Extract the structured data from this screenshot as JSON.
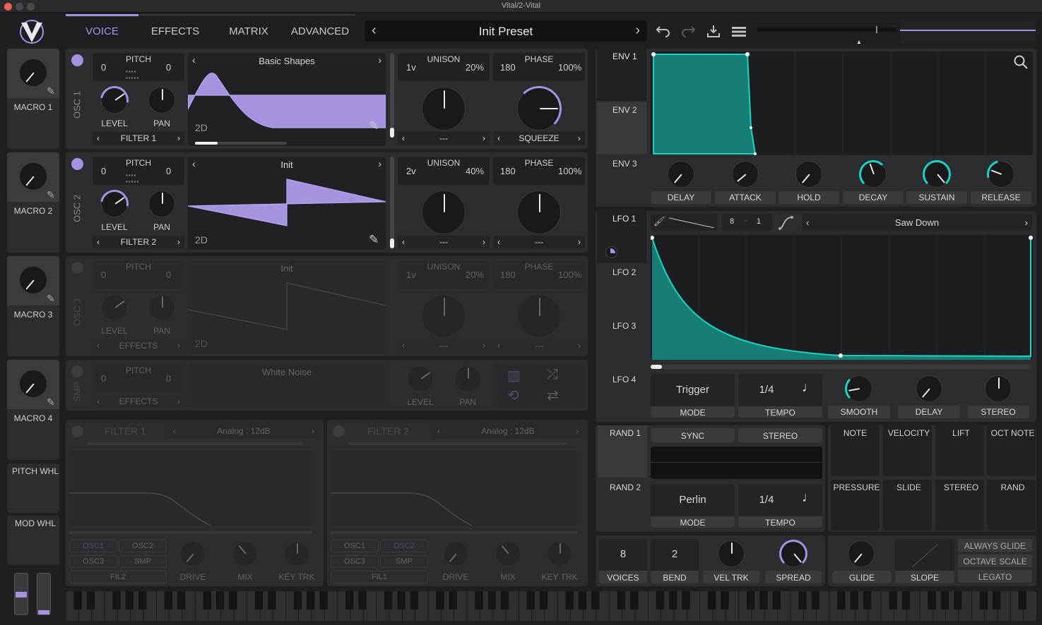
{
  "window": {
    "title": "Vital/2-Vital"
  },
  "nav": {
    "tabs": [
      "VOICE",
      "EFFECTS",
      "MATRIX",
      "ADVANCED"
    ],
    "active": "VOICE"
  },
  "preset": {
    "name": "Init Preset"
  },
  "macros": [
    "MACRO 1",
    "MACRO 2",
    "MACRO 3",
    "MACRO 4"
  ],
  "wheels": {
    "pitch": "PITCH WHL",
    "mod": "MOD WHL"
  },
  "common": {
    "pitch": "PITCH",
    "level": "LEVEL",
    "pan": "PAN",
    "unison": "UNISON",
    "phase": "PHASE",
    "dim2d": "2D",
    "dash": "---"
  },
  "osc1": {
    "label": "OSC 1",
    "transpose": "0",
    "tune": "0",
    "wavetable": "Basic Shapes",
    "voices": "1v",
    "detune": "20%",
    "phase": "180",
    "phase_mix": "100%",
    "dest": "FILTER 1",
    "spectral": "SQUEEZE"
  },
  "osc2": {
    "label": "OSC 2",
    "transpose": "0",
    "tune": "0",
    "wavetable": "Init",
    "voices": "2v",
    "detune": "40%",
    "phase": "180",
    "phase_mix": "100%",
    "dest": "FILTER 2",
    "spectral": "---"
  },
  "osc3": {
    "label": "OSC 3",
    "transpose": "0",
    "tune": "0",
    "wavetable": "Init",
    "voices": "1v",
    "detune": "20%",
    "phase": "180",
    "phase_mix": "100%",
    "dest": "EFFECTS",
    "spectral": "---"
  },
  "smp": {
    "label": "SMP",
    "transpose": "0",
    "tune": "0",
    "sample": "White Noise",
    "dest": "EFFECTS"
  },
  "filter1": {
    "label": "FILTER 1",
    "model": "Analog : 12dB",
    "src": [
      "OSC1",
      "OSC2",
      "OSC3",
      "SMP"
    ],
    "fil": "FIL2",
    "drive": "DRIVE",
    "mix": "MIX",
    "keytrk": "KEY TRK"
  },
  "filter2": {
    "label": "FILTER 2",
    "model": "Analog : 12dB",
    "src": [
      "OSC1",
      "OSC2",
      "OSC3",
      "SMP"
    ],
    "fil": "FIL1",
    "drive": "DRIVE",
    "mix": "MIX",
    "keytrk": "KEY TRK"
  },
  "env": {
    "tabs": [
      "ENV 1",
      "ENV 2",
      "ENV 3"
    ],
    "knobs": [
      "DELAY",
      "ATTACK",
      "HOLD",
      "DECAY",
      "SUSTAIN",
      "RELEASE"
    ]
  },
  "lfo": {
    "tabs": [
      "LFO 1",
      "LFO 2",
      "LFO 3",
      "LFO 4"
    ],
    "grid_x": "8",
    "grid_y": "1",
    "shape": "Saw Down",
    "trigger": "Trigger",
    "mode": "MODE",
    "rate": "1/4",
    "tempo": "TEMPO",
    "knobs": [
      "SMOOTH",
      "DELAY",
      "STEREO"
    ]
  },
  "rand": {
    "tabs": [
      "RAND 1",
      "RAND 2"
    ],
    "sync": "SYNC",
    "stereo": "STEREO",
    "style1": "Perlin",
    "mode": "MODE",
    "rate": "1/4",
    "tempo": "TEMPO"
  },
  "mods": {
    "row1": [
      "NOTE",
      "VELOCITY",
      "LIFT",
      "OCT NOTE"
    ],
    "row2": [
      "PRESSURE",
      "SLIDE",
      "STEREO",
      "RAND"
    ]
  },
  "voice": {
    "voices": "8",
    "voices_lbl": "VOICES",
    "bend": "2",
    "bend_lbl": "BEND",
    "veltrk": "VEL TRK",
    "spread": "SPREAD"
  },
  "glide": {
    "glide": "GLIDE",
    "slope": "SLOPE",
    "always": "ALWAYS GLIDE",
    "octave": "OCTAVE SCALE",
    "legato": "LEGATO"
  },
  "colors": {
    "accent": "#a593e0",
    "teal": "#1bd3c0",
    "bg": "#1e1f22",
    "panel": "#2c2d31"
  }
}
